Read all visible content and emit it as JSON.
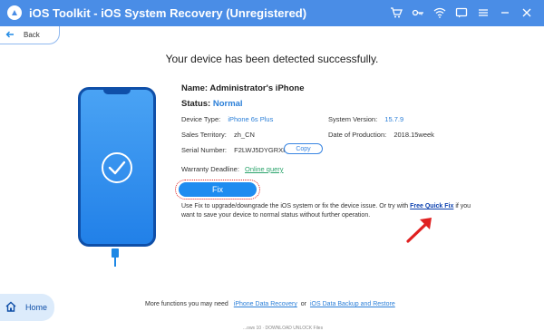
{
  "window": {
    "title": "iOS Toolkit - iOS System Recovery (Unregistered)",
    "accent": "#4a8de6",
    "toolbar_icons": [
      "cart-icon",
      "key-icon",
      "wifi-icon",
      "feedback-icon",
      "menu-icon",
      "minimize-icon",
      "close-icon"
    ]
  },
  "nav": {
    "back_label": "Back",
    "home_label": "Home"
  },
  "main": {
    "heading": "Your device has been detected successfully.",
    "name_label": "Name:",
    "name_value": "Administrator's iPhone",
    "status_label": "Status:",
    "status_value": "Normal",
    "device_type_label": "Device Type:",
    "device_type_value": "iPhone 6s Plus",
    "system_version_label": "System Version:",
    "system_version_value": "15.7.9",
    "sales_territory_label": "Sales Territory:",
    "sales_territory_value": "zh_CN",
    "production_label": "Date of Production:",
    "production_value": "2018.15week",
    "serial_label": "Serial Number:",
    "serial_value": "F2LWJ5DYGRXH",
    "copy_label": "Copy",
    "warranty_label": "Warranty Deadline:",
    "warranty_link": "Online query",
    "fix_label": "Fix",
    "desc_part1": "Use Fix to upgrade/downgrade the iOS system or fix the device issue. Or try with",
    "desc_link": "Free Quick Fix",
    "desc_part2": "if you want to save your device to normal status without further operation."
  },
  "footer": {
    "prefix": "More functions you may need",
    "link1": "iPhone Data Recovery",
    "or": "or",
    "link2": "iOS Data Backup and Restore"
  },
  "cut_text": "...ows 10 · DOWNLOAD UNLOCK Files"
}
